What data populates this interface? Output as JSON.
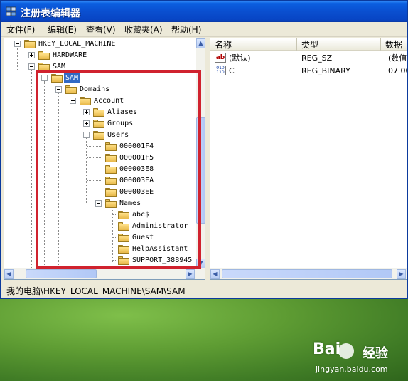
{
  "window": {
    "title": "注册表编辑器"
  },
  "menu": [
    {
      "label": "文件(F)"
    },
    {
      "label": "编辑(E)"
    },
    {
      "label": "查看(V)"
    },
    {
      "label": "收藏夹(A)"
    },
    {
      "label": "帮助(H)"
    }
  ],
  "tree": {
    "root": "HKEY_LOCAL_MACHINE",
    "hardware": "HARDWARE",
    "sam": "SAM",
    "sam_selected": "SAM",
    "domains": "Domains",
    "account": "Account",
    "aliases": "Aliases",
    "groups": "Groups",
    "users": "Users",
    "user_ids": [
      "000001F4",
      "000001F5",
      "000003E8",
      "000003EA",
      "000003EE"
    ],
    "names": "Names",
    "user_names": [
      "abc$",
      "Administrator",
      "Guest",
      "HelpAssistant",
      "SUPPORT_388945"
    ]
  },
  "values_pane": {
    "columns": [
      "名称",
      "类型",
      "数据"
    ],
    "rows": [
      {
        "name": "(默认)",
        "type": "REG_SZ",
        "data": "(数值",
        "icon": "ab-string-icon"
      },
      {
        "name": "C",
        "type": "REG_BINARY",
        "data": "07 00",
        "icon": "binary-value-icon"
      }
    ]
  },
  "status": {
    "path": "我的电脑\\HKEY_LOCAL_MACHINE\\SAM\\SAM"
  },
  "watermark": {
    "brand": "Bai",
    "brand_cn": "经验",
    "url": "jingyan.baidu.com"
  },
  "colors": {
    "titlebar": "#0a4fd0",
    "highlight_box": "#d0222e",
    "selection": "#316ac5"
  }
}
